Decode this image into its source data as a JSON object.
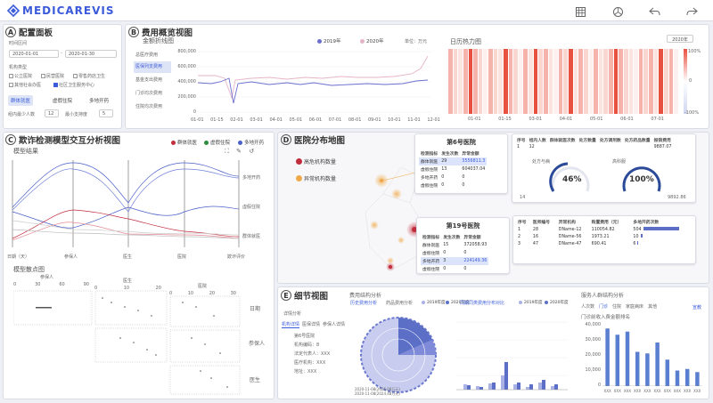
{
  "brand": "MEDICAREVIS",
  "config": {
    "letter": "A",
    "title": "配置面板",
    "time_label": "时间区间",
    "date_start": "2020-01-01",
    "date_end": "2020-01-30",
    "inst_label": "机构类型",
    "checkboxes": [
      "公立医院",
      "民营医院",
      "零售药店卫生",
      "其他社会办医",
      "社区卫生服务中心"
    ],
    "buttons": [
      "群体就医",
      "虚假住院",
      "多地开药"
    ],
    "min_people_label": "组内最少人数",
    "min_people": "12",
    "min_freq_label": "最小支持度",
    "min_freq": "5"
  },
  "cost": {
    "letter": "B",
    "title": "费用概览视图",
    "subtitle": "金额折线图",
    "legend": [
      "2019年",
      "2020年"
    ],
    "unit": "单位：万元",
    "rows": [
      "总医疗费用",
      "医保列支费用",
      "基金支出费用",
      "门诊均次费用",
      "住院均次费用"
    ],
    "yticks": [
      "800,000",
      "600,000",
      "400,000",
      "200,000",
      "0"
    ],
    "xticks": [
      "01-01",
      "01-15",
      "02-01",
      "03-01",
      "04-01",
      "05-01",
      "06-01",
      "07-01",
      "08-01",
      "09-01",
      "10-01",
      "11-01",
      "12-01"
    ],
    "heat_title": "日历热力图",
    "year": "2020年",
    "heat_scale": [
      "100%",
      "0",
      "-100%"
    ],
    "heat_x": [
      "01-01",
      "01-15",
      "03-01",
      "04-01",
      "05-01",
      "06-01",
      "07-01"
    ]
  },
  "fraud": {
    "letter": "C",
    "title": "欺诈检测模型交互分析视图",
    "legend": [
      "群体就医",
      "虚假住院",
      "多地开药"
    ],
    "model_title": "模型结果",
    "axes": [
      "日期（天）",
      "参保人",
      "医生",
      "医院",
      "欺诈评价"
    ],
    "right_labels": [
      "多地开药",
      "虚假住院",
      "群体就医"
    ],
    "scatter_title": "模型散点图",
    "scatter_labels": [
      "参保人",
      "医生",
      "医院"
    ],
    "scatter_ticks": [
      "0",
      "30",
      "60",
      "90",
      "0",
      "10",
      "20",
      "0",
      "10",
      "20",
      "30"
    ],
    "row_labels": [
      "日期",
      "参保人",
      "医生"
    ]
  },
  "map": {
    "letter": "D",
    "title": "医院分布地图",
    "legend": [
      "高危机构数量",
      "异常机构数量"
    ],
    "h6": {
      "name": "第6号医院",
      "headers": [
        "检测指标",
        "发生次数",
        "异常金额"
      ],
      "rows": [
        [
          "群体就医",
          "29",
          "3556811.3"
        ],
        [
          "虚假住院",
          "13",
          "604037.04"
        ],
        [
          "多地开药",
          "0",
          "0"
        ],
        [
          "虚假住院",
          "0",
          "0"
        ]
      ]
    },
    "t6": {
      "headers": [
        "序号",
        "组内人数",
        "群体就医次数",
        "处方数量",
        "处方调剂数",
        "处方药品数量",
        "报销费用"
      ],
      "row": [
        "1",
        "12",
        "",
        "",
        "",
        "",
        "9887.07"
      ],
      "g1label": "处方与病",
      "g1": "46%",
      "g2label": "高科服",
      "g2": "100%",
      "foot": [
        "14",
        "",
        "",
        "",
        "",
        "",
        "9892.86"
      ]
    },
    "h19": {
      "name": "第19号医院",
      "headers": [
        "检测指标",
        "发生次数",
        "异常金额"
      ],
      "rows": [
        [
          "群体就医",
          "15",
          "372058.93"
        ],
        [
          "虚假住院",
          "0",
          "0"
        ],
        [
          "多地开药",
          "3",
          "224149.36"
        ],
        [
          "虚假住院",
          "0",
          "0"
        ]
      ]
    },
    "t19": {
      "headers": [
        "序号",
        "医师编号",
        "异常机构",
        "购置费用（元）",
        "多地开药次数"
      ],
      "rows": [
        [
          "1",
          "28",
          "DName-12",
          "110054.82",
          "504"
        ],
        [
          "2",
          "16",
          "DName-56",
          "1973.21",
          "10"
        ],
        [
          "3",
          "47",
          "DName-47",
          "690.41",
          "6"
        ]
      ]
    }
  },
  "detail": {
    "letter": "E",
    "title": "细节视图",
    "tabs": [
      "详情分析",
      "机构详情",
      "医保详情",
      "参保人详情"
    ],
    "info": [
      "第6号医院",
      "机构编码：8",
      "法定代表人：XXX",
      "医疗机构：XXX",
      "地址：XXX"
    ],
    "struct_title": "费用结构分析",
    "struct_tabs": [
      "历史费用分析",
      "药品费用分析",
      "2019年度",
      "2020年度"
    ],
    "compare_title": "同期同类费用分布对比",
    "compare_legend": [
      "2019年度",
      "2020年度"
    ],
    "pie_note": "2020-11-08(2026.08万元)\n2020-11-08(2024.48万元)",
    "rank_title": "服务人群结构分析",
    "rank_tabs": [
      "人次数",
      "门诊",
      "住院",
      "家庭病床",
      "其他"
    ],
    "rank_sub": "门诊前收入费金额排名",
    "rank_unit": "宣教",
    "rank_y": [
      "40,000",
      "30,000",
      "20,000",
      "10,000",
      "0"
    ],
    "rank_x": [
      "XXX",
      "XXX",
      "XXX",
      "XXX",
      "XXX",
      "XXX",
      "XXX",
      "XXX",
      "XXX",
      "XXX"
    ]
  },
  "chart_data": [
    {
      "type": "bar",
      "title": "门诊前收入费金额排名",
      "categories": [
        "XXX",
        "XXX",
        "XXX",
        "XXX",
        "XXX",
        "XXX",
        "XXX",
        "XXX",
        "XXX",
        "XXX"
      ],
      "values": [
        37000,
        33000,
        35000,
        22000,
        21000,
        28000,
        17000,
        10000,
        11000,
        9000
      ],
      "ylim": [
        0,
        40000
      ]
    },
    {
      "type": "heatmap",
      "title": "日历热力图",
      "colors": [
        "#f5b3ab",
        "#f9d6d0",
        "#fbe3df",
        "#e8503f",
        "#fdf0ee"
      ]
    }
  ]
}
